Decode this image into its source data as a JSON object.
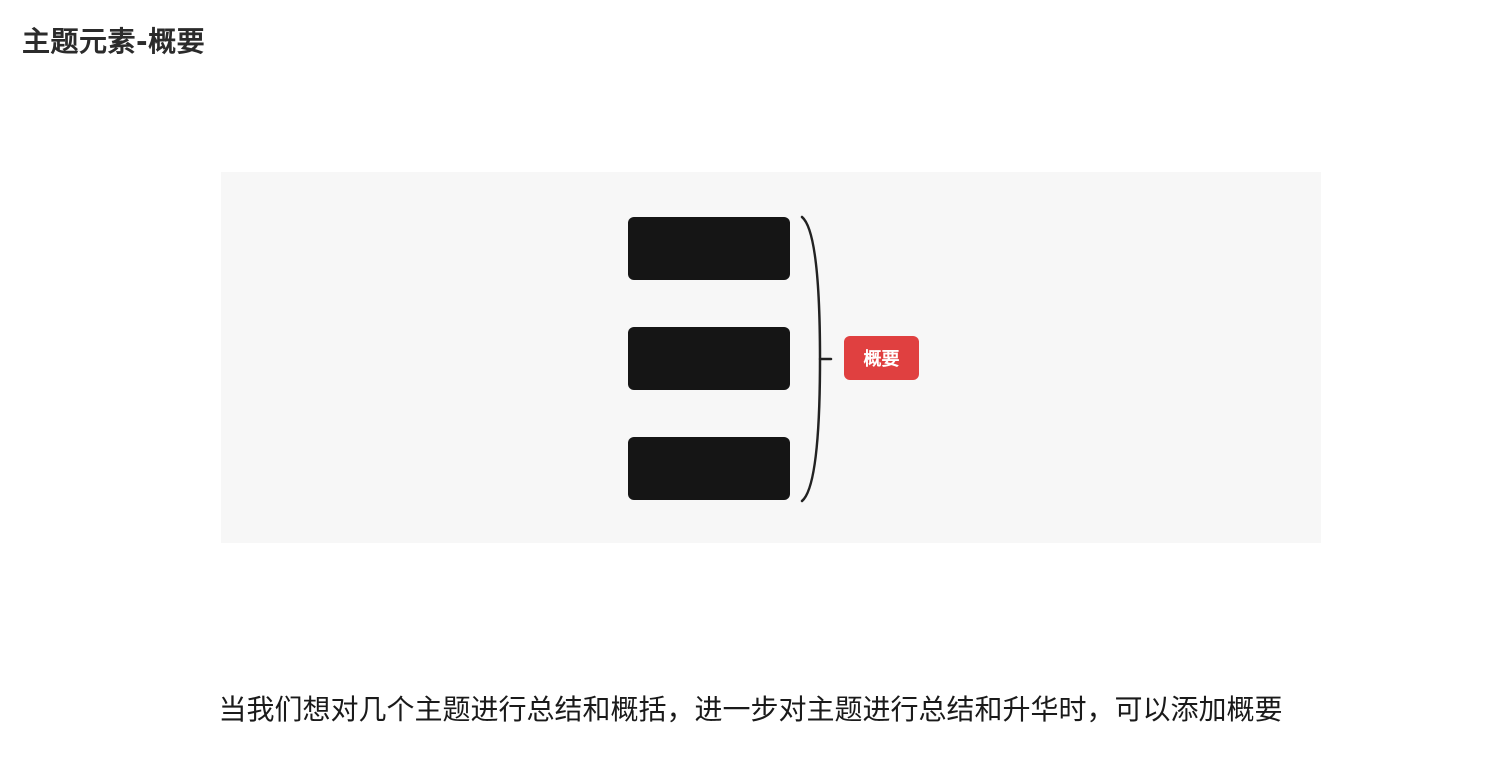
{
  "page": {
    "title": "主题元素-概要"
  },
  "diagram": {
    "summary_label": "概要",
    "topic_count": 3,
    "colors": {
      "canvas_background": "#f7f7f7",
      "topic_fill": "#151515",
      "summary_fill": "#e04040",
      "summary_text": "#ffffff",
      "bracket": "#222222"
    },
    "icons": [
      "summary-bracket-icon"
    ]
  },
  "caption": {
    "text": "当我们想对几个主题进行总结和概括，进一步对主题进行总结和升华时，可以添加概要"
  }
}
